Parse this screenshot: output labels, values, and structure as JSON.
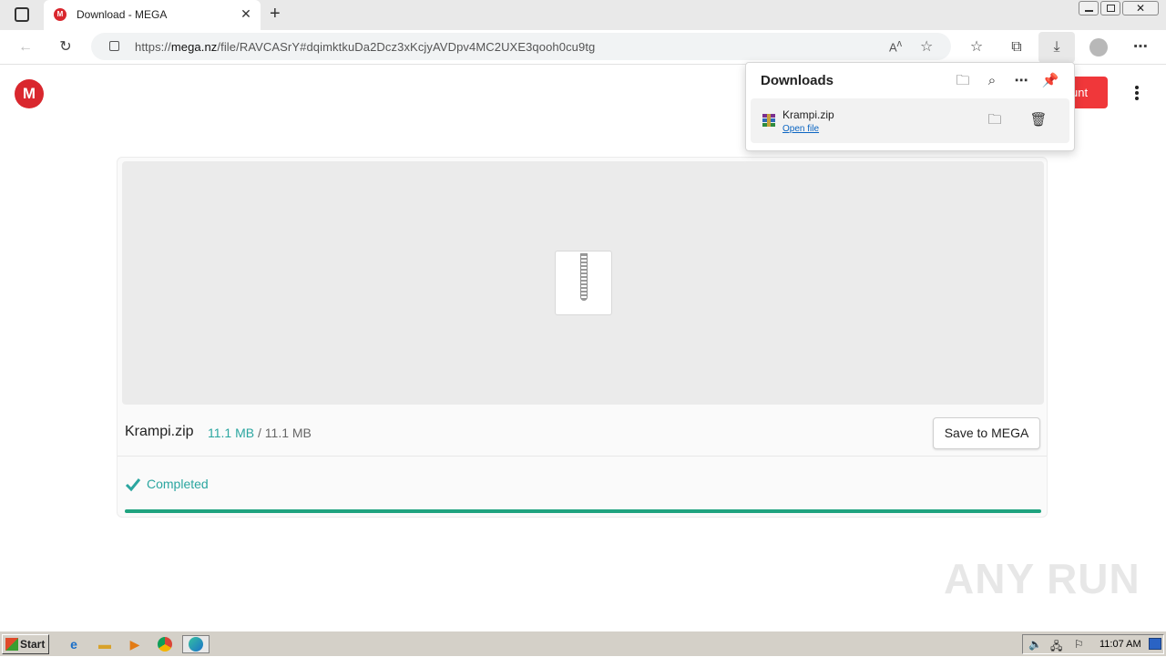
{
  "browser": {
    "tab_title": "Download - MEGA",
    "url_prefix": "https://",
    "url_host": "mega.nz",
    "url_path": "/file/RAVCASrY#dqimktkuDa2Dcz3xKcjyAVDpv4MC2UXE3qooh0cu9tg"
  },
  "page": {
    "logo_letter": "M",
    "create_account_label": "unt",
    "file_name": "Krampi.zip",
    "downloaded_size": "11.1 MB",
    "size_separator": "/",
    "total_size": "11.1 MB",
    "save_button_label": "Save to MEGA",
    "status_text": "Completed",
    "progress_percent": 100,
    "accent_color": "#2ba6a0",
    "brand_color": "#d9272e"
  },
  "downloads_panel": {
    "title": "Downloads",
    "items": [
      {
        "name": "Krampi.zip",
        "action_label": "Open file"
      }
    ]
  },
  "taskbar": {
    "start_label": "Start",
    "clock": "11:07 AM"
  },
  "watermark": "ANY RUN"
}
